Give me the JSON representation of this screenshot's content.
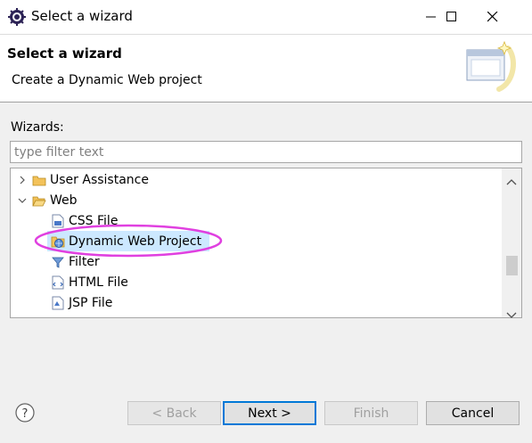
{
  "window": {
    "title": "Select a wizard"
  },
  "banner": {
    "title": "Select a wizard",
    "description": "Create a Dynamic Web project"
  },
  "wizards": {
    "label": "Wizards:",
    "filter_placeholder": "type filter text",
    "tree": [
      {
        "label": "User Assistance",
        "level": 0,
        "expanded": false,
        "icon": "folder-icon"
      },
      {
        "label": "Web",
        "level": 0,
        "expanded": true,
        "icon": "folder-open-icon"
      },
      {
        "label": "CSS File",
        "level": 1,
        "icon": "css-file-icon"
      },
      {
        "label": "Dynamic Web Project",
        "level": 1,
        "icon": "dynamic-web-project-icon",
        "selected": true
      },
      {
        "label": "Filter",
        "level": 1,
        "icon": "filter-icon"
      },
      {
        "label": "HTML File",
        "level": 1,
        "icon": "html-file-icon"
      },
      {
        "label": "JSP File",
        "level": 1,
        "icon": "jsp-file-icon"
      }
    ]
  },
  "buttons": {
    "back": "< Back",
    "next": "Next >",
    "finish": "Finish",
    "cancel": "Cancel",
    "help": "?"
  },
  "colors": {
    "selection": "#cce8ff",
    "annotation": "#e040e0",
    "default_button_border": "#0078d7"
  }
}
